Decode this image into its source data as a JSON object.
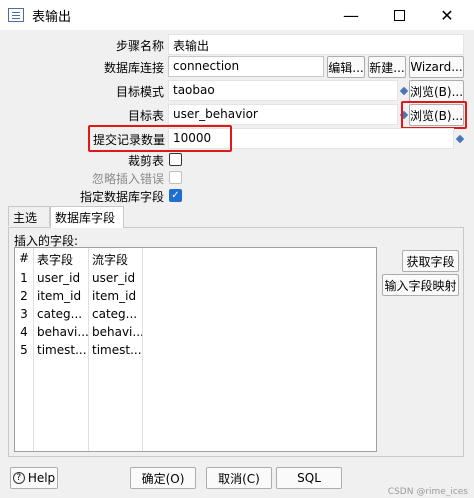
{
  "window": {
    "title": "表输出",
    "minimize": "—",
    "close": "✕"
  },
  "form": {
    "step_name_label": "步骤名称",
    "step_name_value": "表输出",
    "connection_label": "数据库连接",
    "connection_value": "connection",
    "edit_button": "编辑...",
    "new_button": "新建...",
    "wizard_button": "Wizard...",
    "schema_label": "目标模式",
    "schema_value": "taobao",
    "schema_browse": "浏览(B)...",
    "table_label": "目标表",
    "table_value": "user_behavior",
    "table_browse": "浏览(B)...",
    "commit_label": "提交记录数量",
    "commit_value": "10000",
    "truncate_label": "裁剪表",
    "ignore_errors_label": "忽略插入错误",
    "specify_fields_label": "指定数据库字段",
    "checkmark": "✓"
  },
  "tabs": [
    {
      "label": "主选项"
    },
    {
      "label": "数据库字段"
    }
  ],
  "fields_section": {
    "label": "插入的字段:",
    "columns": [
      "#",
      "表字段",
      "流字段"
    ],
    "rows": [
      {
        "num": "1",
        "table_field": "user_id",
        "stream_field": "user_id"
      },
      {
        "num": "2",
        "table_field": "item_id",
        "stream_field": "item_id"
      },
      {
        "num": "3",
        "table_field": "categ...",
        "stream_field": "categ..."
      },
      {
        "num": "4",
        "table_field": "behavi...",
        "stream_field": "behavi..."
      },
      {
        "num": "5",
        "table_field": "timest...",
        "stream_field": "timest..."
      }
    ],
    "get_fields_button": "获取字段",
    "map_fields_button": "输入字段映射"
  },
  "footer": {
    "help_label": "Help",
    "help_icon": "?",
    "ok_button": "确定(O)",
    "cancel_button": "取消(C)",
    "sql_button": "SQL",
    "watermark": "CSDN @rime_ices"
  },
  "colors": {
    "highlight": "#e01818",
    "accent": "#1f6fd1"
  }
}
